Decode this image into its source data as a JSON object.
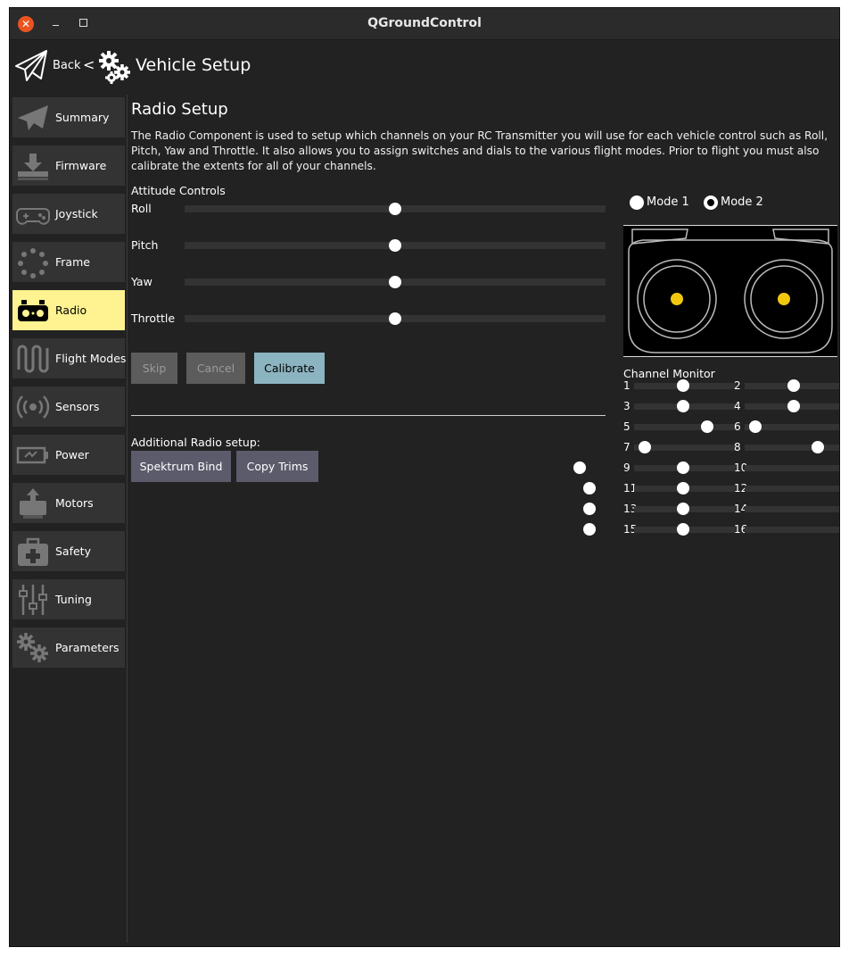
{
  "window": {
    "title": "QGroundControl"
  },
  "toolbar": {
    "back_label": "Back",
    "separator": "<",
    "page_title": "Vehicle Setup"
  },
  "sidebar": {
    "items": [
      {
        "label": "Summary",
        "icon": "paper-plane-icon",
        "active": false
      },
      {
        "label": "Firmware",
        "icon": "download-icon",
        "active": false
      },
      {
        "label": "Joystick",
        "icon": "gamepad-icon",
        "active": false
      },
      {
        "label": "Frame",
        "icon": "frame-dots-icon",
        "active": false
      },
      {
        "label": "Radio",
        "icon": "radio-transmitter-icon",
        "active": true
      },
      {
        "label": "Flight Modes",
        "icon": "flight-modes-icon",
        "active": false
      },
      {
        "label": "Sensors",
        "icon": "sensors-icon",
        "active": false
      },
      {
        "label": "Power",
        "icon": "battery-icon",
        "active": false
      },
      {
        "label": "Motors",
        "icon": "motors-icon",
        "active": false
      },
      {
        "label": "Safety",
        "icon": "first-aid-kit-icon",
        "active": false
      },
      {
        "label": "Tuning",
        "icon": "sliders-icon",
        "active": false
      },
      {
        "label": "Parameters",
        "icon": "gears-icon",
        "active": false
      }
    ]
  },
  "main": {
    "title": "Radio Setup",
    "description": "The Radio Component is used to setup which channels on your RC Transmitter you will use for each vehicle control such as Roll, Pitch, Yaw and Throttle. It also allows you to assign switches and dials to the various flight modes. Prior to flight you must also calibrate the extents for all of your channels.",
    "attitude_label": "Attitude Controls",
    "attitude": [
      {
        "label": "Roll",
        "value": 0.5
      },
      {
        "label": "Pitch",
        "value": 0.5
      },
      {
        "label": "Yaw",
        "value": 0.5
      },
      {
        "label": "Throttle",
        "value": 0.5
      }
    ],
    "buttons": {
      "skip": "Skip",
      "cancel": "Cancel",
      "calibrate": "Calibrate"
    },
    "additional_label": "Additional Radio setup:",
    "spektrum_bind": "Spektrum Bind",
    "copy_trims": "Copy Trims",
    "mode1_label": "Mode 1",
    "mode2_label": "Mode 2",
    "selected_mode": 2,
    "channel_monitor_label": "Channel Monitor",
    "channels": [
      {
        "num": "1",
        "value": 0.5
      },
      {
        "num": "2",
        "value": 0.5
      },
      {
        "num": "3",
        "value": 0.5
      },
      {
        "num": "4",
        "value": 0.5
      },
      {
        "num": "5",
        "value": 0.75
      },
      {
        "num": "6",
        "value": 0.1
      },
      {
        "num": "7",
        "value": 0.1
      },
      {
        "num": "8",
        "value": 0.75
      },
      {
        "num": "9",
        "value": 0.5
      },
      {
        "num": "10",
        "value": null
      },
      {
        "num": "11",
        "value": 0.5
      },
      {
        "num": "12",
        "value": null
      },
      {
        "num": "13",
        "value": 0.5
      },
      {
        "num": "14",
        "value": null
      },
      {
        "num": "15",
        "value": 0.5
      },
      {
        "num": "16",
        "value": null
      }
    ]
  },
  "colors": {
    "background": "#222222",
    "active_nav": "#fff291",
    "calibrate": "#8cb3c0",
    "action_button": "#5b5b6b",
    "stick_dot": "#f2c80f",
    "close_button": "#e95420"
  }
}
